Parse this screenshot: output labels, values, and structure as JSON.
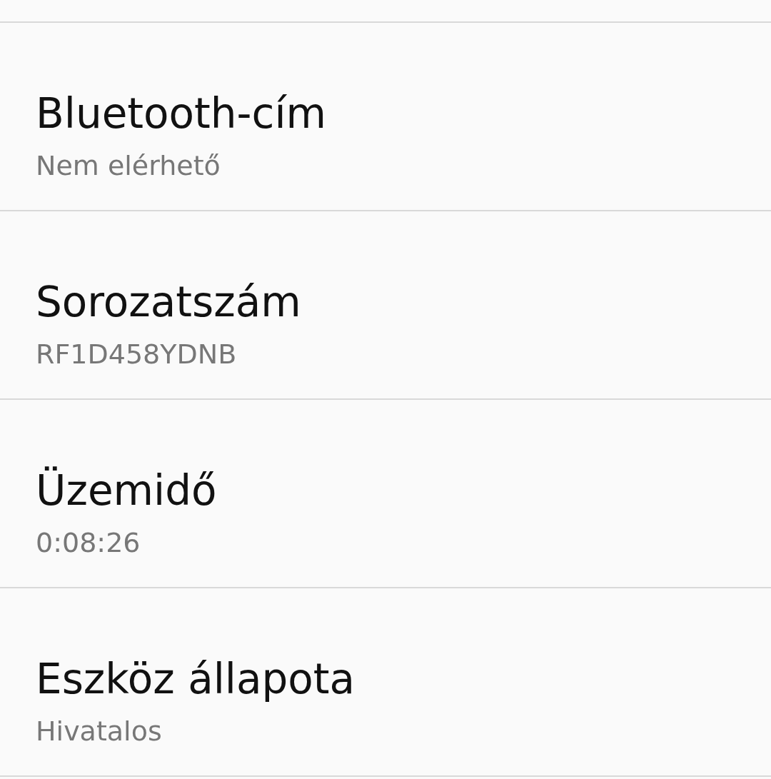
{
  "items": [
    {
      "title": "Bluetooth-cím",
      "value": "Nem elérhető"
    },
    {
      "title": "Sorozatszám",
      "value": "RF1D458YDNB"
    },
    {
      "title": "Üzemidő",
      "value": "0:08:26"
    },
    {
      "title": "Eszköz állapota",
      "value": "Hivatalos"
    }
  ]
}
